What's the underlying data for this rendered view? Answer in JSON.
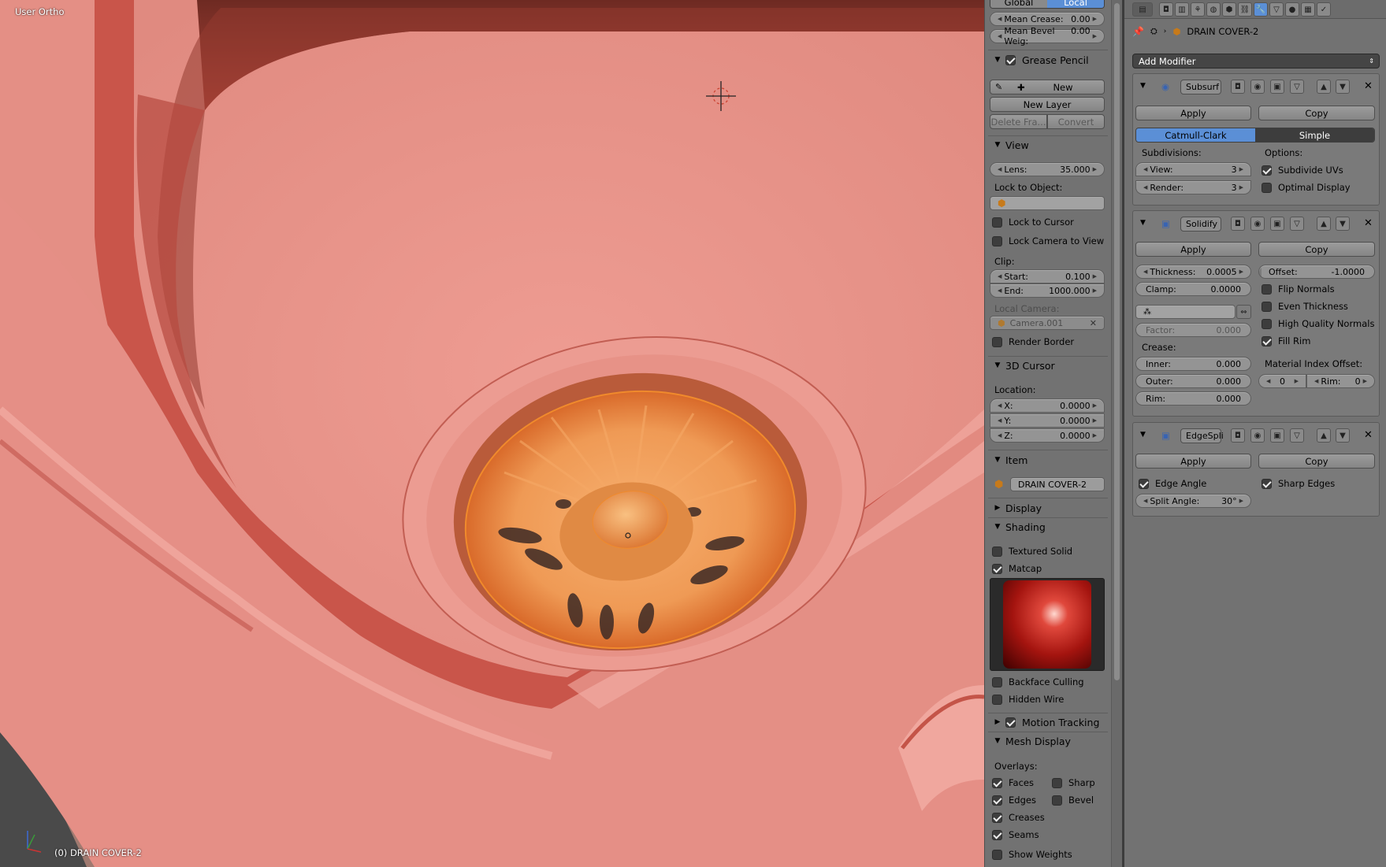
{
  "viewport": {
    "view_label": "User Ortho",
    "object_label": "(0) DRAIN COVER-2"
  },
  "npanel": {
    "global_tab": "Global",
    "local_tab": "Local",
    "mean_crease": {
      "label": "Mean Crease:",
      "value": "0.00"
    },
    "mean_bevel": {
      "label": "Mean Bevel Weig:",
      "value": "0.00"
    },
    "grease_pencil": {
      "title": "Grease Pencil",
      "new": "New",
      "new_layer": "New Layer",
      "delete_frame": "Delete Fra...",
      "convert": "Convert"
    },
    "view": {
      "title": "View",
      "lens": {
        "label": "Lens:",
        "value": "35.000"
      },
      "lock_to_object": "Lock to Object:",
      "lock_to_cursor": "Lock to Cursor",
      "lock_camera": "Lock Camera to View",
      "clip": "Clip:",
      "clip_start": {
        "label": "Start:",
        "value": "0.100"
      },
      "clip_end": {
        "label": "End:",
        "value": "1000.000"
      },
      "local_camera": "Local Camera:",
      "local_camera_value": "Camera.001",
      "render_border": "Render Border"
    },
    "cursor": {
      "title": "3D Cursor",
      "location": "Location:",
      "x": {
        "label": "X:",
        "value": "0.0000"
      },
      "y": {
        "label": "Y:",
        "value": "0.0000"
      },
      "z": {
        "label": "Z:",
        "value": "0.0000"
      }
    },
    "item": {
      "title": "Item",
      "name": "DRAIN COVER-2"
    },
    "display_title": "Display",
    "shading": {
      "title": "Shading",
      "textured_solid": "Textured Solid",
      "matcap": "Matcap",
      "backface_culling": "Backface Culling",
      "hidden_wire": "Hidden Wire"
    },
    "motion_tracking": "Motion Tracking",
    "mesh_display": {
      "title": "Mesh Display",
      "overlays": "Overlays:",
      "faces": "Faces",
      "sharp": "Sharp",
      "edges": "Edges",
      "bevel": "Bevel",
      "creases": "Creases",
      "seams": "Seams",
      "show_weights": "Show Weights"
    }
  },
  "props": {
    "breadcrumb_object": "DRAIN COVER-2",
    "add_modifier": "Add Modifier",
    "subsurf": {
      "name": "Subsurf",
      "apply": "Apply",
      "copy": "Copy",
      "catmull": "Catmull-Clark",
      "simple": "Simple",
      "subdivisions": "Subdivisions:",
      "options": "Options:",
      "view": {
        "label": "View:",
        "value": "3"
      },
      "render": {
        "label": "Render:",
        "value": "3"
      },
      "subdivide_uvs": "Subdivide UVs",
      "optimal_display": "Optimal Display"
    },
    "solidify": {
      "name": "Solidify",
      "apply": "Apply",
      "copy": "Copy",
      "thickness": {
        "label": "Thickness:",
        "value": "0.0005"
      },
      "offset": {
        "label": "Offset:",
        "value": "-1.0000"
      },
      "clamp": {
        "label": "Clamp:",
        "value": "0.0000"
      },
      "flip_normals": "Flip Normals",
      "even_thickness": "Even Thickness",
      "high_quality": "High Quality Normals",
      "fill_rim": "Fill Rim",
      "factor": {
        "label": "Factor:",
        "value": "0.000"
      },
      "crease": "Crease:",
      "inner": {
        "label": "Inner:",
        "value": "0.000"
      },
      "outer": {
        "label": "Outer:",
        "value": "0.000"
      },
      "rim": {
        "label": "Rim:",
        "value": "0.000"
      },
      "material_index_offset": "Material Index Offset:",
      "mat_offset_value": "0",
      "mat_rim": {
        "label": "Rim:",
        "value": "0"
      }
    },
    "edgesplit": {
      "name": "EdgeSpli",
      "apply": "Apply",
      "copy": "Copy",
      "edge_angle": "Edge Angle",
      "sharp_edges": "Sharp Edges",
      "split_angle": {
        "label": "Split Angle:",
        "value": "30°"
      }
    }
  },
  "colors": {
    "sink": "#e9968c",
    "accent_blue": "#5b8fd6",
    "selection_orange": "#f08a2c"
  }
}
